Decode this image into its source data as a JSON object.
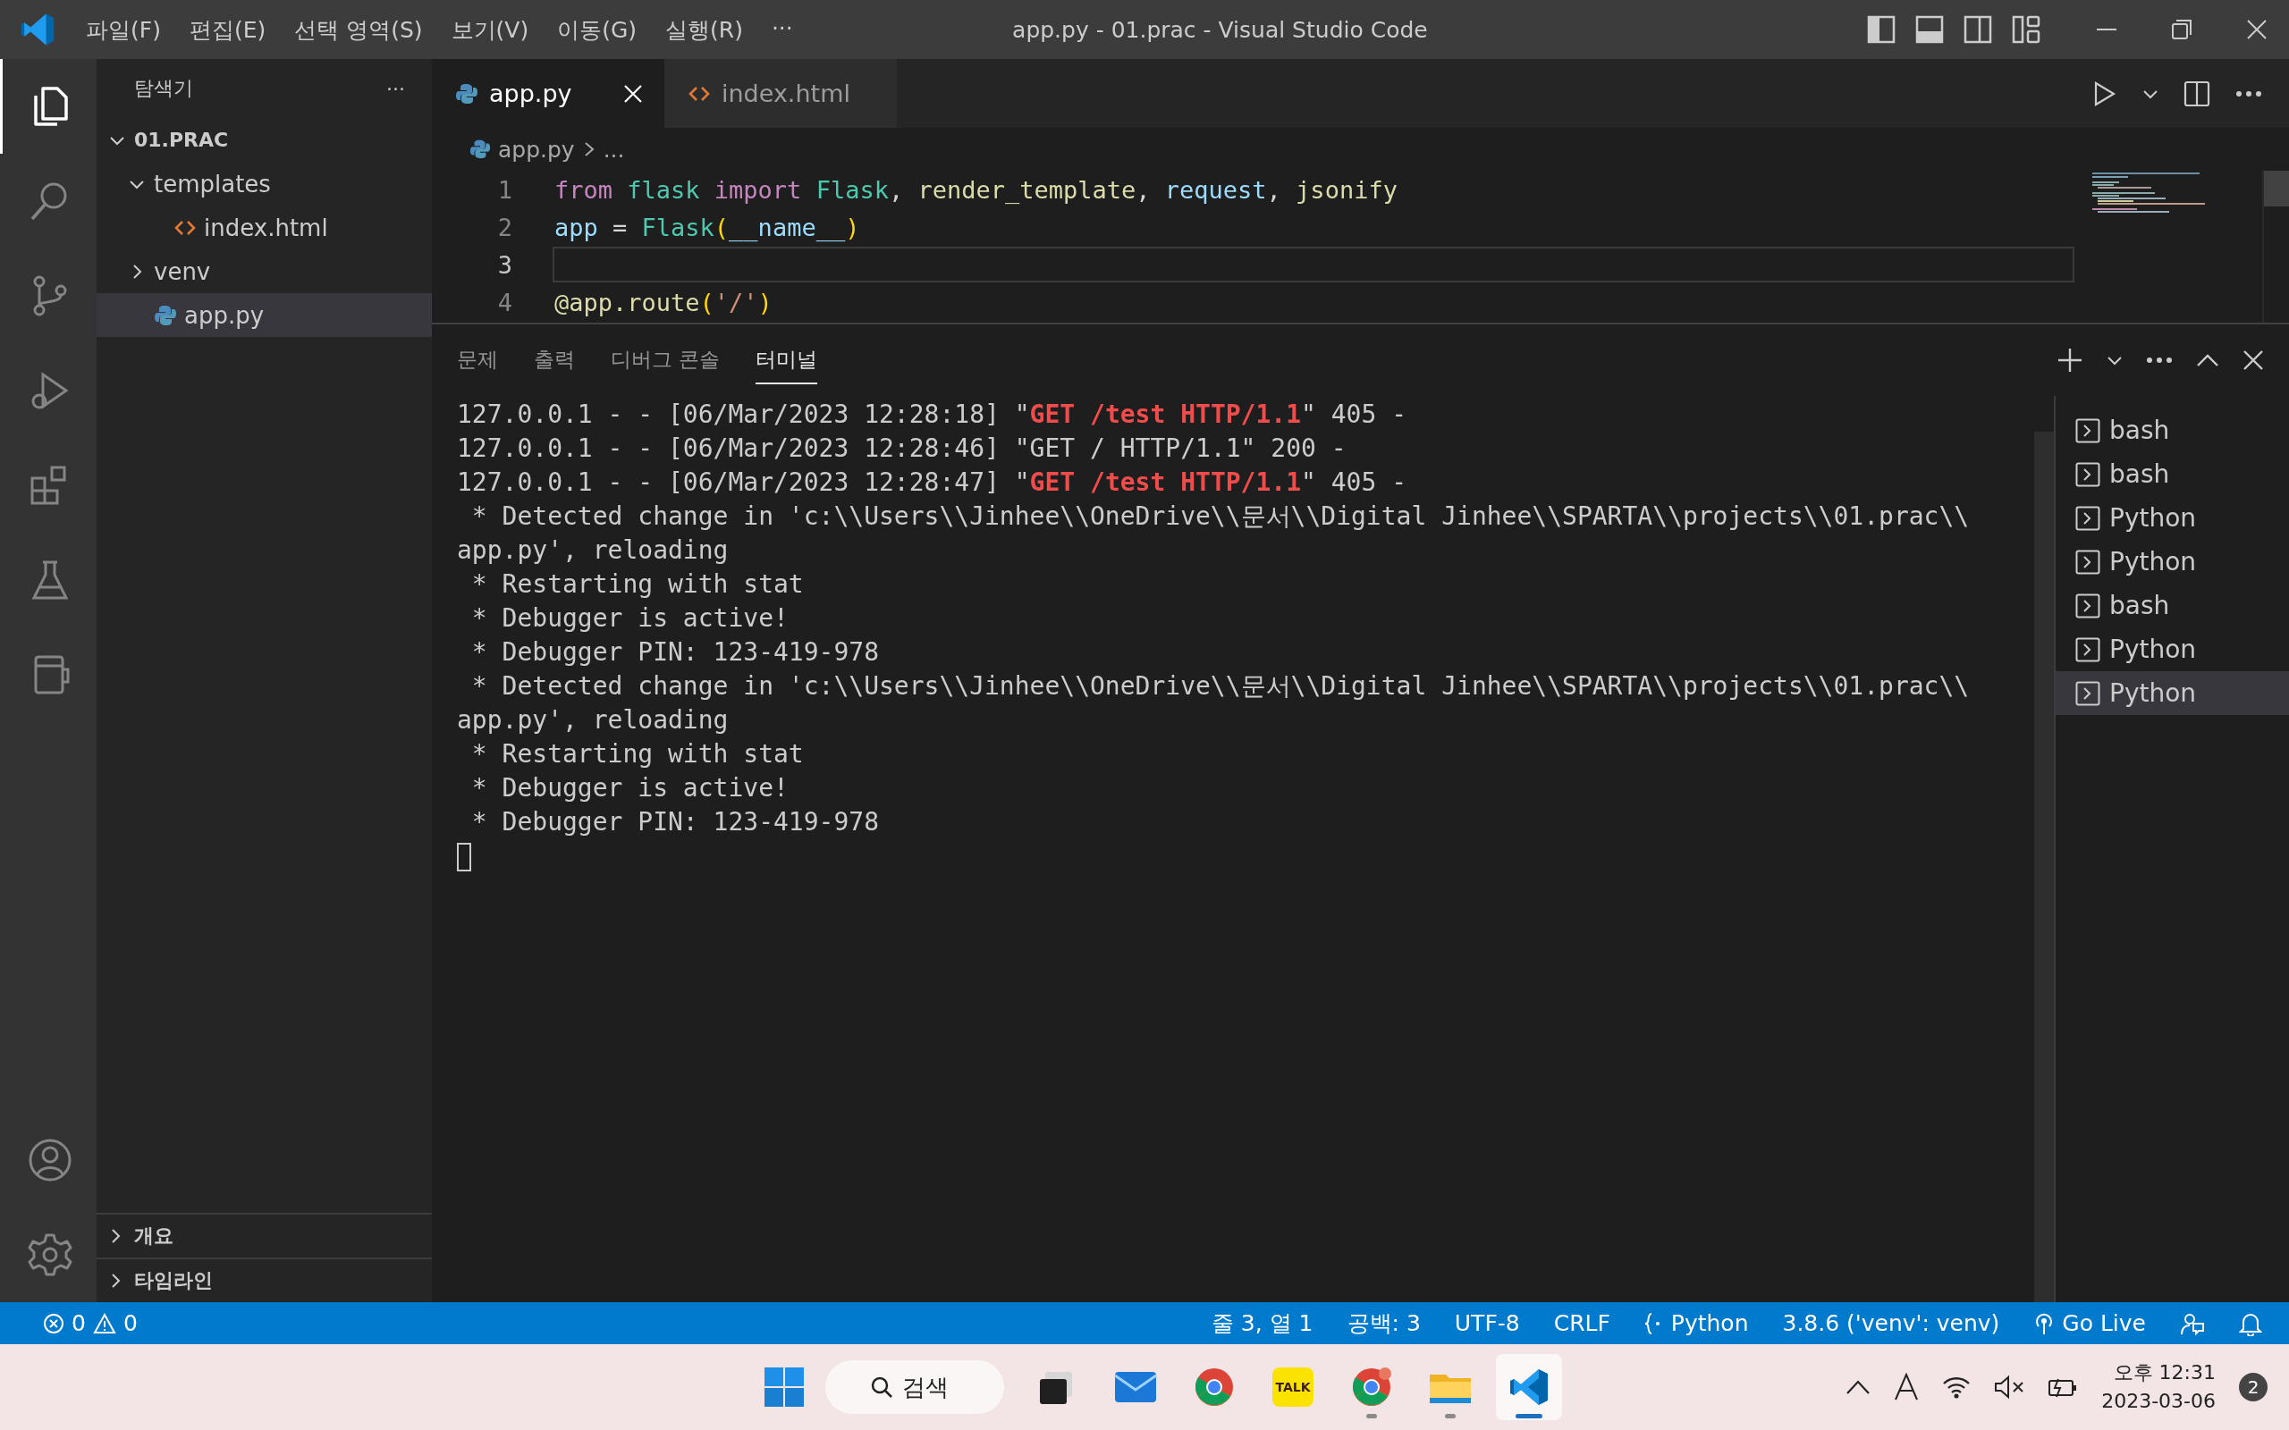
{
  "title_bar": {
    "menus": [
      "파일(F)",
      "편집(E)",
      "선택 영역(S)",
      "보기(V)",
      "이동(G)",
      "실행(R)"
    ],
    "more": "···",
    "title": "app.py - 01.prac - Visual Studio Code"
  },
  "activity_bar": {
    "items": [
      {
        "kind": "files",
        "selected": true
      },
      {
        "kind": "search",
        "selected": false
      },
      {
        "kind": "source-control",
        "selected": false
      },
      {
        "kind": "run",
        "selected": false
      },
      {
        "kind": "extensions",
        "selected": false
      },
      {
        "kind": "testing",
        "selected": false
      },
      {
        "kind": "notebook",
        "selected": false
      }
    ],
    "bottom": [
      {
        "kind": "account"
      },
      {
        "kind": "settings"
      }
    ]
  },
  "sidebar": {
    "title": "탐색기",
    "more": "···",
    "tree": [
      {
        "label": "01.PRAC",
        "kind": "root",
        "expanded": true,
        "selected": false,
        "children": [
          {
            "label": "templates",
            "kind": "folder",
            "expanded": true,
            "selected": false,
            "children": [
              {
                "label": "index.html",
                "kind": "html",
                "selected": false
              }
            ]
          },
          {
            "label": "venv",
            "kind": "folder",
            "expanded": false,
            "selected": false
          },
          {
            "label": "app.py",
            "kind": "python",
            "selected": true
          }
        ]
      }
    ],
    "sections": [
      {
        "label": "개요",
        "expanded": false
      },
      {
        "label": "타임라인",
        "expanded": false
      }
    ]
  },
  "editor": {
    "tabs": [
      {
        "label": "app.py",
        "kind": "python",
        "selected": true
      },
      {
        "label": "index.html",
        "kind": "html",
        "selected": false
      }
    ],
    "breadcrumb": [
      {
        "label": "app.py",
        "kind": "python"
      },
      {
        "label": "...",
        "kind": "more"
      }
    ],
    "lines": [
      {
        "number": "1",
        "current": false,
        "tokens": [
          {
            "text": "from",
            "kind": "keyword"
          },
          {
            "text": " flask",
            "kind": "module"
          },
          {
            "text": " import",
            "kind": "keyword"
          },
          {
            "text": " Flask",
            "kind": "class"
          },
          {
            "text": ",",
            "kind": "plain"
          },
          {
            "text": " render_template",
            "kind": "func"
          },
          {
            "text": ",",
            "kind": "plain"
          },
          {
            "text": " request",
            "kind": "var"
          },
          {
            "text": ",",
            "kind": "plain"
          },
          {
            "text": " jsonify",
            "kind": "func"
          }
        ]
      },
      {
        "number": "2",
        "current": false,
        "tokens": [
          {
            "text": "app",
            "kind": "var"
          },
          {
            "text": " =",
            "kind": "plain"
          },
          {
            "text": " Flask",
            "kind": "class"
          },
          {
            "text": "(",
            "kind": "paren"
          },
          {
            "text": "__name__",
            "kind": "var"
          },
          {
            "text": ")",
            "kind": "paren"
          }
        ]
      },
      {
        "number": "3",
        "current": true
      },
      {
        "number": "4",
        "current": false,
        "tokens": [
          {
            "text": "@app.route",
            "kind": "func"
          },
          {
            "text": "(",
            "kind": "paren"
          },
          {
            "text": "'/'",
            "kind": "string"
          },
          {
            "text": ")",
            "kind": "paren"
          }
        ]
      }
    ]
  },
  "panel": {
    "tabs": [
      {
        "label": "문제",
        "selected": false
      },
      {
        "label": "출력",
        "selected": false
      },
      {
        "label": "디버그 콘솔",
        "selected": false
      },
      {
        "label": "터미널",
        "selected": true
      }
    ],
    "terminal_lines": [
      "127.0.0.1 - - [06/Mar/2023 12:28:18] \"**GET /test HTTP/1.1**\" 405 -",
      "127.0.0.1 - - [06/Mar/2023 12:28:46] \"GET / HTTP/1.1\" 200 -",
      "127.0.0.1 - - [06/Mar/2023 12:28:47] \"**GET /test HTTP/1.1**\" 405 -",
      " * Detected change in 'c:\\\\Users\\\\Jinhee\\\\OneDrive\\\\문서\\\\Digital Jinhee\\\\SPARTA\\\\projects\\\\01.prac\\\\",
      "app.py', reloading",
      " * Restarting with stat",
      " * Debugger is active!",
      " * Debugger PIN: 123-419-978",
      " * Detected change in 'c:\\\\Users\\\\Jinhee\\\\OneDrive\\\\문서\\\\Digital Jinhee\\\\SPARTA\\\\projects\\\\01.prac\\\\",
      "app.py', reloading",
      " * Restarting with stat",
      " * Debugger is active!",
      " * Debugger PIN: 123-419-978"
    ],
    "terminals": [
      {
        "label": "bash",
        "selected": false
      },
      {
        "label": "bash",
        "selected": false
      },
      {
        "label": "Python",
        "selected": false
      },
      {
        "label": "Python",
        "selected": false
      },
      {
        "label": "bash",
        "selected": false
      },
      {
        "label": "Python",
        "selected": false
      },
      {
        "label": "Python",
        "selected": true
      }
    ]
  },
  "status_bar": {
    "errors": "0",
    "warnings": "0",
    "items": [
      {
        "label": "줄 3, 열 1",
        "kind": "text"
      },
      {
        "label": "공백: 3",
        "kind": "text"
      },
      {
        "label": "UTF-8",
        "kind": "text"
      },
      {
        "label": "CRLF",
        "kind": "text"
      },
      {
        "label": "Python",
        "kind": "language"
      },
      {
        "label": "3.8.6 ('venv': venv)",
        "kind": "text"
      },
      {
        "label": "Go Live",
        "kind": "live"
      }
    ]
  },
  "taskbar": {
    "search": "검색",
    "apps": [
      {
        "kind": "task-view",
        "running": false,
        "selected": false
      },
      {
        "kind": "mail",
        "running": false,
        "selected": false
      },
      {
        "kind": "chrome",
        "running": false,
        "selected": false
      },
      {
        "kind": "talk",
        "label": "TALK",
        "running": false,
        "selected": false
      },
      {
        "kind": "chrome-alt",
        "running": true,
        "selected": false
      },
      {
        "kind": "folder",
        "running": true,
        "selected": false
      },
      {
        "kind": "vscode",
        "running": true,
        "selected": true
      }
    ],
    "time": "오후 12:31",
    "date": "2023-03-06",
    "notifications": "2"
  }
}
